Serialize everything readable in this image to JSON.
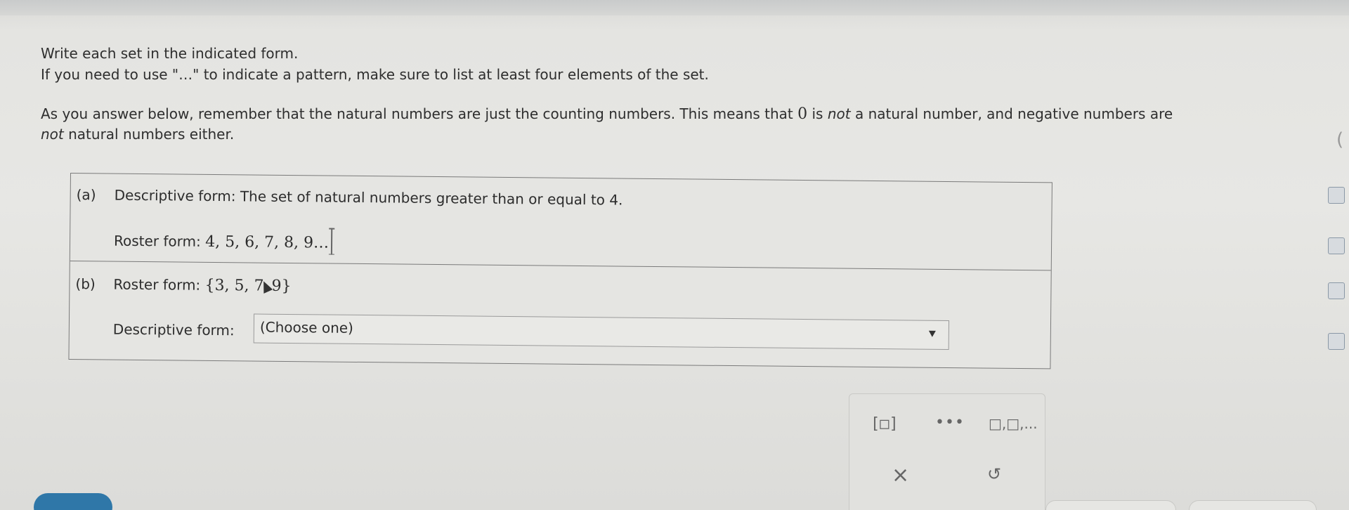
{
  "instructions": {
    "line1": "Write each set in the indicated form.",
    "line2": "If you need to use \"…\" to indicate a pattern, make sure to list at least four elements of the set.",
    "note_before": "As you answer below, remember that the natural numbers are just the counting numbers. This means that ",
    "note_zero": "0",
    "note_is": " is ",
    "note_not1": "not",
    "note_mid": " a natural number, and negative numbers are",
    "note_not2": "not",
    "note_end": " natural numbers either."
  },
  "part_a": {
    "label": "(a)",
    "descriptive_prefix": "Descriptive form: ",
    "descriptive_text": "The set of natural numbers greater than or equal to 4.",
    "roster_prefix": "Roster form: ",
    "roster_value": "4, 5, 6, 7, 8, 9…"
  },
  "part_b": {
    "label": "(b)",
    "roster_prefix": "Roster form: ",
    "roster_open": "{3, 5, 7",
    "roster_close": "9}",
    "descriptive_prefix": "Descriptive form: ",
    "select_value": "(Choose one)"
  },
  "tools": {
    "brace_icon": "[□]",
    "dots_icon": "•••",
    "boxes_icon": "□,□,...",
    "clear_icon": "×",
    "undo_icon": "↺"
  },
  "colors": {
    "check_button": "#2f77a8",
    "border": "#7a7a7a"
  }
}
